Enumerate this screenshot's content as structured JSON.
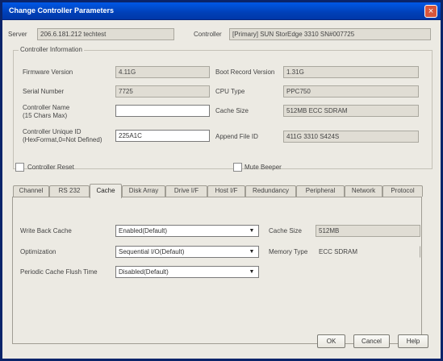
{
  "window": {
    "title": "Change Controller Parameters",
    "close_glyph": "×"
  },
  "header": {
    "server_label": "Server",
    "server_value": "206.6.181.212 techtest",
    "controller_label": "Controller",
    "controller_value": "[Primary] SUN StorEdge 3310 SN#007725"
  },
  "controller_info": {
    "group_title": "Controller Information",
    "firmware_version_label": "Firmware Version",
    "firmware_version": "4.11G",
    "serial_number_label": "Serial Number",
    "serial_number": "7725",
    "controller_name_label_1": "Controller Name",
    "controller_name_label_2": "(15 Chars Max)",
    "controller_name_value": "",
    "unique_id_label_1": "Controller Unique ID",
    "unique_id_label_2": "(HexFormat,0=Not Defined)",
    "unique_id_value": "225A1C",
    "boot_record_label": "Boot Record Version",
    "boot_record": "1.31G",
    "cpu_type_label": "CPU Type",
    "cpu_type": "PPC750",
    "cache_size_label": "Cache Size",
    "cache_size": "512MB ECC SDRAM",
    "append_file_label": "Append File ID",
    "append_file": "411G 3310 S424S"
  },
  "options": {
    "controller_reset": "Controller Reset",
    "mute_beeper": "Mute Beeper"
  },
  "tabs": [
    "Channel",
    "RS 232",
    "Cache",
    "Disk Array",
    "Drive I/F",
    "Host I/F",
    "Redundancy",
    "Peripheral",
    "Network",
    "Protocol"
  ],
  "cache_tab": {
    "write_back_label": "Write Back Cache",
    "write_back_value": "Enabled(Default)",
    "optimization_label": "Optimization",
    "optimization_value": "Sequential I/O(Default)",
    "flush_label": "Periodic Cache Flush Time",
    "flush_value": "Disabled(Default)",
    "cache_size_label": "Cache Size",
    "cache_size_value": "512MB",
    "memory_type_label": "Memory Type",
    "memory_type_value": "ECC SDRAM",
    "dropdown_glyph": "▼"
  },
  "buttons": {
    "ok": "OK",
    "cancel": "Cancel",
    "help": "Help"
  }
}
